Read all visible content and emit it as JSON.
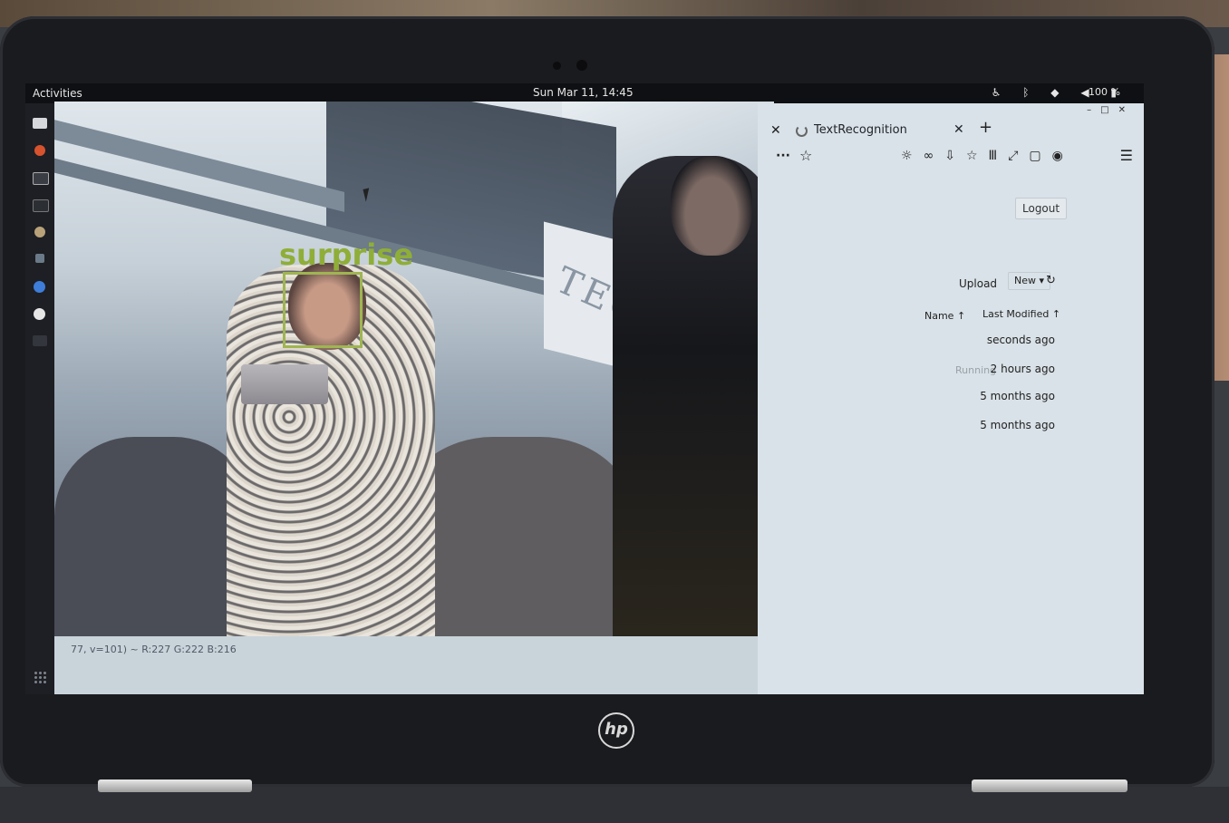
{
  "topbar": {
    "activities": "Activities",
    "clock": "Sun Mar 11, 14:45",
    "tray_icons": [
      "accessibility-icon",
      "bluetooth-icon",
      "wifi-icon",
      "volume-icon",
      "battery-icon"
    ],
    "battery": "100 %"
  },
  "camera_window": {
    "emotion_label": "surprise",
    "banner_text": "TECH",
    "pixel_readout": "77, v=101) ~ R:227 G:222 B:216",
    "face_box_color": "#9fb552"
  },
  "browser": {
    "tab_title": "TextRecognition",
    "new_tab": "+",
    "toolbar_more": "···",
    "logout": "Logout",
    "upload": "Upload",
    "new": "New ▾",
    "columns": {
      "name": "Name ↑",
      "last_modified": "Last Modified ↑"
    },
    "running_label": "Running",
    "rows": [
      "seconds ago",
      "2 hours ago",
      "5 months ago",
      "5 months ago"
    ]
  },
  "laptop": {
    "brand": "hp"
  }
}
